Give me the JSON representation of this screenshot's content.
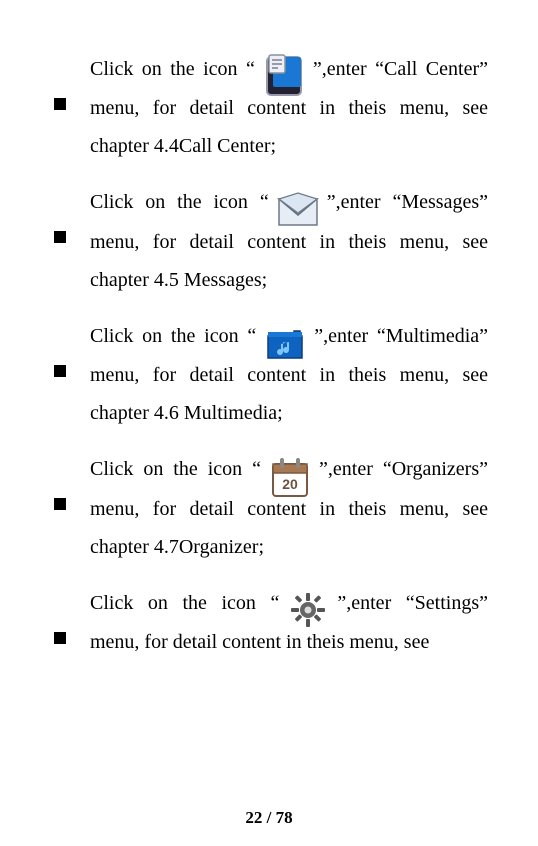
{
  "items": [
    {
      "pre": "Click on the icon “",
      "iconName": "call-center-icon",
      "post": "”,enter “Call Center” menu, for detail content in theis menu, see chapter 4.4Call Center;"
    },
    {
      "pre": "Click on the icon “",
      "iconName": "messages-icon",
      "post": "”,enter “Messages” menu, for detail content in theis menu, see chapter 4.5 Messages;"
    },
    {
      "pre": "Click on the icon “",
      "iconName": "multimedia-icon",
      "post": "”,enter “Multimedia” menu, for detail content in theis menu, see chapter 4.6 Multimedia;"
    },
    {
      "pre": "Click on the icon “",
      "iconName": "organizers-icon",
      "post": "”,enter “Organizers” menu, for detail content in theis menu, see chapter 4.7Organizer;"
    },
    {
      "pre": "Click on the icon “",
      "iconName": "settings-icon",
      "post": "”,enter “Settings” menu, for detail content in theis menu, see"
    }
  ],
  "pageNumber": "22 / 78"
}
